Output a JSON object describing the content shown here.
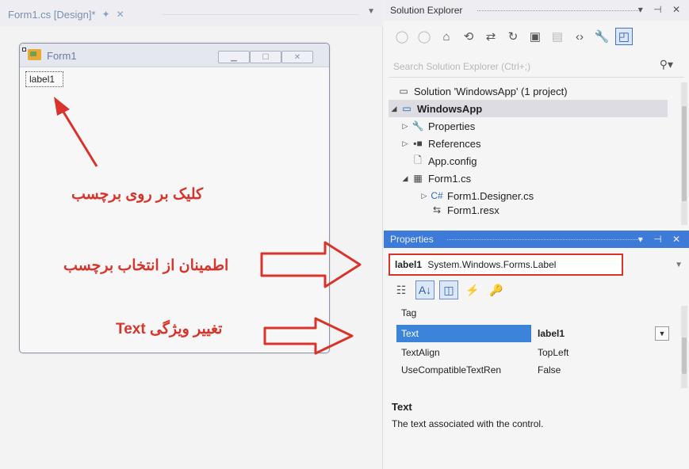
{
  "designer": {
    "tab_label": "Form1.cs [Design]*",
    "tab_pin": "✦",
    "tab_close": "✕",
    "form": {
      "title": "Form1",
      "label_text": "label1"
    }
  },
  "annotations": {
    "click_label": "کلیک بر روی برچسب",
    "ensure_selection": "اطمینان از انتخاب برچسب",
    "change_text": "تغییر ویژگی  Text"
  },
  "solution_explorer": {
    "title": "Solution Explorer",
    "search_placeholder": "Search Solution Explorer (Ctrl+;)",
    "tree": [
      {
        "label": "Solution 'WindowsApp' (1 project)",
        "expander": "",
        "icon": "solution-icon"
      },
      {
        "label": "WindowsApp",
        "expander": "◢",
        "icon": "csharp-project-icon",
        "selected": true
      },
      {
        "label": "Properties",
        "expander": "▷",
        "icon": "wrench-icon"
      },
      {
        "label": "References",
        "expander": "▷",
        "icon": "references-icon"
      },
      {
        "label": "App.config",
        "expander": "",
        "icon": "config-file-icon"
      },
      {
        "label": "Form1.cs",
        "expander": "◢",
        "icon": "form-file-icon"
      },
      {
        "label": "Form1.Designer.cs",
        "expander": "▷",
        "icon": "csharp-file-icon"
      },
      {
        "label": "Form1.resx",
        "expander": "",
        "icon": "resx-file-icon"
      }
    ]
  },
  "properties": {
    "title": "Properties",
    "object_name": "label1",
    "object_type": "System.Windows.Forms.Label",
    "rows": [
      {
        "name": "Tag",
        "value": ""
      },
      {
        "name": "Text",
        "value": "label1"
      },
      {
        "name": "TextAlign",
        "value": "TopLeft"
      },
      {
        "name": "UseCompatibleTextRen",
        "value": "False"
      }
    ],
    "description_title": "Text",
    "description_text": "The text associated with the control."
  }
}
